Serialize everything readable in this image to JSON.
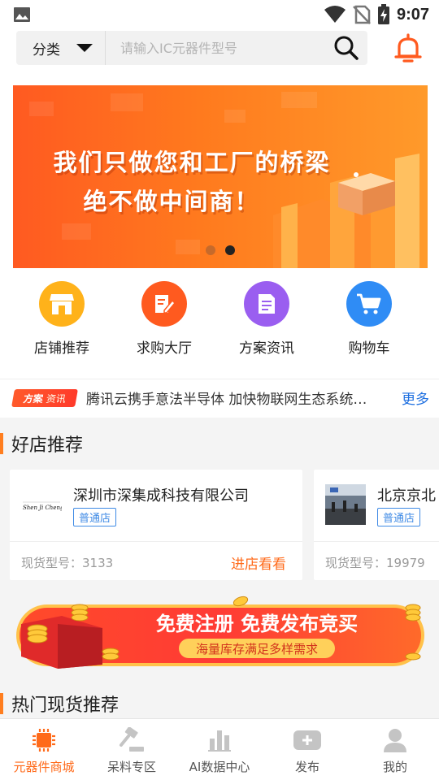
{
  "status_bar": {
    "time": "9:07"
  },
  "header": {
    "category_label": "分类",
    "search_placeholder": "请输入IC元器件型号"
  },
  "banner": {
    "line1": "我们只做您和工厂的桥梁",
    "line2": "绝不做中间商！",
    "slide_count": 2,
    "active_slide": 2
  },
  "quick_menu": [
    {
      "label": "店铺推荐",
      "icon": "shop-icon",
      "color": "#ffb21a"
    },
    {
      "label": "求购大厅",
      "icon": "edit-icon",
      "color": "#ff5a1f"
    },
    {
      "label": "方案资讯",
      "icon": "document-icon",
      "color": "#9a5ef0"
    },
    {
      "label": "购物车",
      "icon": "cart-icon",
      "color": "#2f8cf5"
    }
  ],
  "news": {
    "badge_tag1": "方案",
    "badge_tag2": "资讯",
    "headline": "腾讯云携手意法半导体 加快物联网生态系统建设",
    "more": "更多"
  },
  "sections": {
    "good_shops": "好店推荐",
    "hot_stock": "热门现货推荐"
  },
  "shops": [
    {
      "name": "深圳市深集成科技有限公司",
      "type": "普通店",
      "stock": "现货型号：3133",
      "enter": "进店看看",
      "logo_text": "Shen Ji Cheng"
    },
    {
      "name": "北京京北",
      "type": "普通店",
      "stock": "现货型号：19979"
    }
  ],
  "promo": {
    "title": "免费注册 免费发布竞买",
    "subtitle": "海量库存满足多样需求"
  },
  "bottom_nav": [
    {
      "label": "元器件商城",
      "icon": "chip-icon",
      "active": true
    },
    {
      "label": "呆料专区",
      "icon": "gavel-icon",
      "active": false
    },
    {
      "label": "AI数据中心",
      "icon": "bar-chart-icon",
      "active": false
    },
    {
      "label": "发布",
      "icon": "plus-icon",
      "active": false
    },
    {
      "label": "我的",
      "icon": "user-icon",
      "active": false
    }
  ],
  "colors": {
    "accent": "#ff6a1a",
    "link_blue": "#1e6fe0",
    "badge_blue": "#3f8ae5"
  }
}
